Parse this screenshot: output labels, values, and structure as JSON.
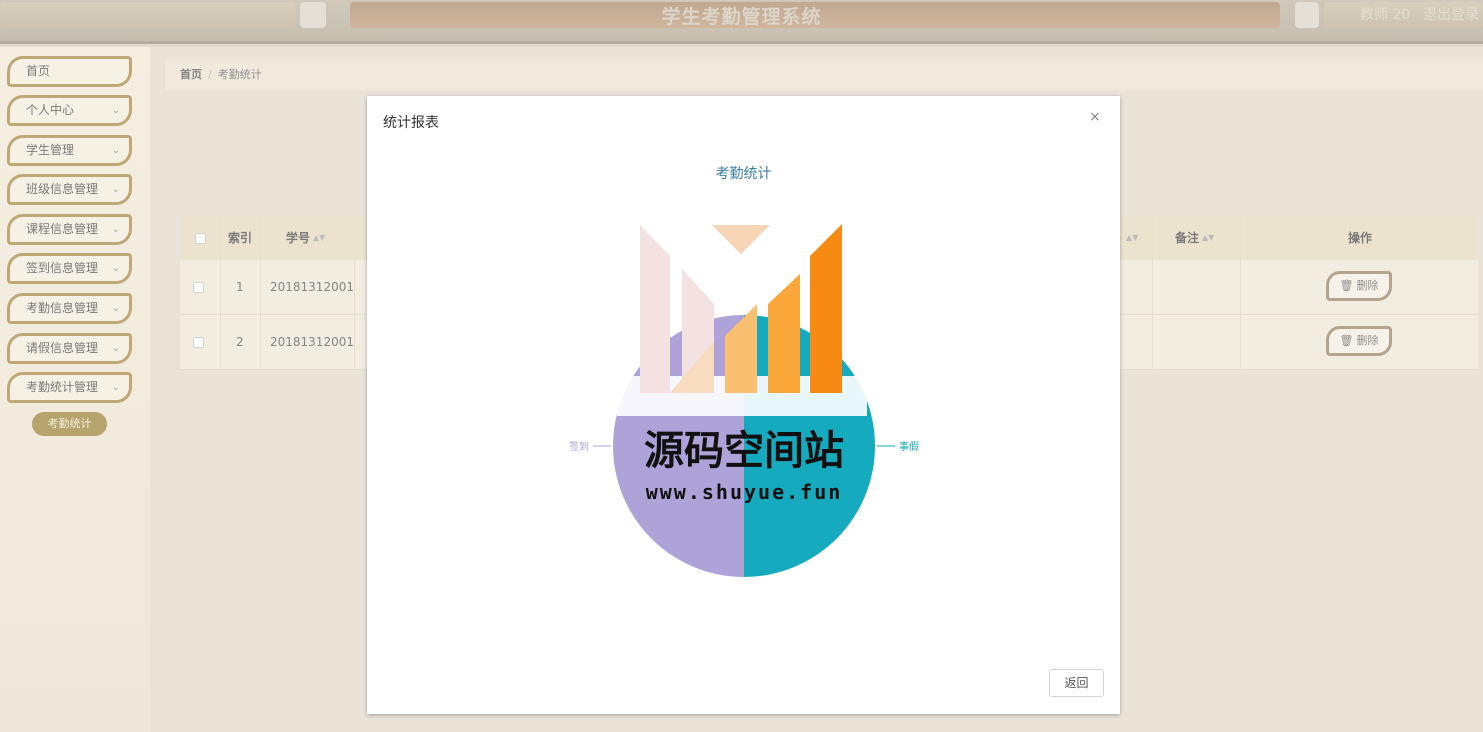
{
  "header": {
    "title": "学生考勤管理系统",
    "user": "教师 20",
    "logout": "退出登录"
  },
  "sidebar": {
    "items": [
      {
        "label": "首页",
        "has_children": false
      },
      {
        "label": "个人中心",
        "has_children": true
      },
      {
        "label": "学生管理",
        "has_children": true
      },
      {
        "label": "班级信息管理",
        "has_children": true
      },
      {
        "label": "课程信息管理",
        "has_children": true
      },
      {
        "label": "签到信息管理",
        "has_children": true
      },
      {
        "label": "考勤信息管理",
        "has_children": true
      },
      {
        "label": "请假信息管理",
        "has_children": true
      },
      {
        "label": "考勤统计管理",
        "has_children": true
      }
    ],
    "active_subitem": "考勤统计"
  },
  "breadcrumb": {
    "home": "首页",
    "current": "考勤统计"
  },
  "table": {
    "headers": {
      "index": "索引",
      "student_no": "学号",
      "remark": "备注",
      "action": "操作"
    },
    "rows": [
      {
        "index": "1",
        "student_no": "20181312001"
      },
      {
        "index": "2",
        "student_no": "20181312001"
      }
    ],
    "delete_label": "删除"
  },
  "modal": {
    "title": "统计报表",
    "close": "×",
    "return_label": "返回"
  },
  "watermark": {
    "line1": "源码空间站",
    "line2": "www.shuyue.fun"
  },
  "chart_data": {
    "type": "pie",
    "title": "考勤统计",
    "categories": [
      "签到",
      "事假"
    ],
    "values": [
      1,
      1
    ],
    "colors": [
      "#aea3d9",
      "#16aabf"
    ],
    "legend": "none"
  }
}
